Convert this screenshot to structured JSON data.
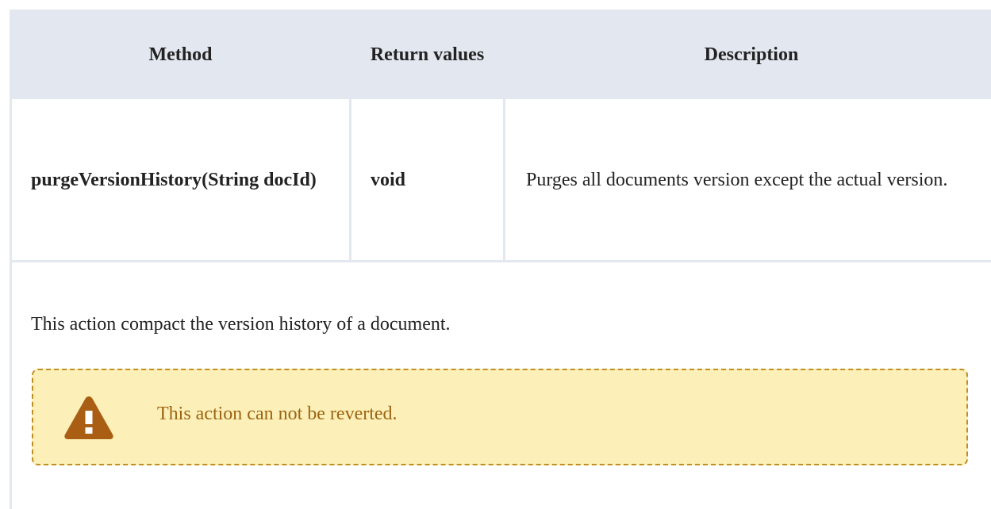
{
  "table": {
    "headers": {
      "method": "Method",
      "return_values": "Return values",
      "description": "Description"
    },
    "rows": [
      {
        "method": "purgeVersionHistory(String docId)",
        "return_value": "void",
        "description": "Purges all documents version except the actual version."
      }
    ]
  },
  "paragraph": "This action compact the version history of a document.",
  "warning": {
    "icon": "warning-triangle-icon",
    "text": "This action can not be reverted.",
    "colors": {
      "background": "#fcf0b8",
      "border": "#c18e22",
      "text": "#9c6412",
      "icon": "#a95e13"
    }
  }
}
